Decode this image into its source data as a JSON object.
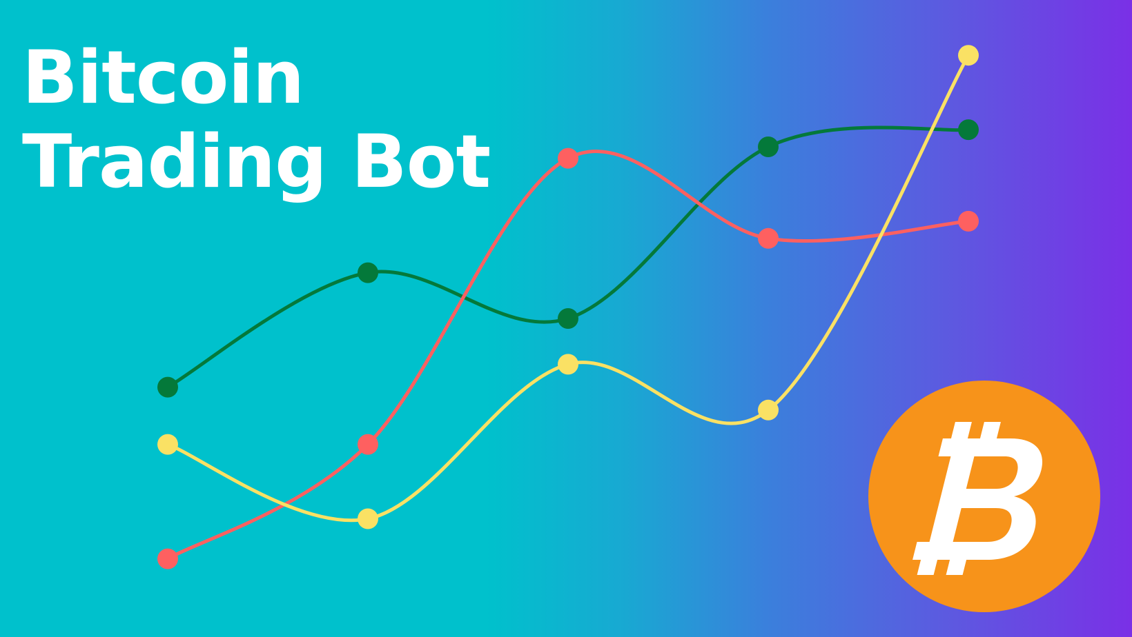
{
  "title": {
    "line1": "Bitcoin",
    "line2": "Trading Bot"
  },
  "colors": {
    "text": "#ffffff",
    "background_start": "#00c1cc",
    "background_end": "#7a30e6",
    "coin": "#f7931a",
    "coin_symbol": "#ffffff"
  },
  "logo": {
    "icon": "bitcoin-logo-icon"
  },
  "chart_data": {
    "type": "line",
    "x": [
      1,
      2,
      3,
      4,
      5
    ],
    "ylim": [
      0,
      100
    ],
    "grid": false,
    "smooth": true,
    "series": [
      {
        "color": "#04793a",
        "values": [
          38,
          58,
          50,
          80,
          83
        ]
      },
      {
        "color": "#fe6060",
        "values": [
          8,
          28,
          78,
          64,
          67
        ]
      },
      {
        "color": "#fae164",
        "values": [
          28,
          15,
          42,
          34,
          96
        ]
      }
    ]
  }
}
